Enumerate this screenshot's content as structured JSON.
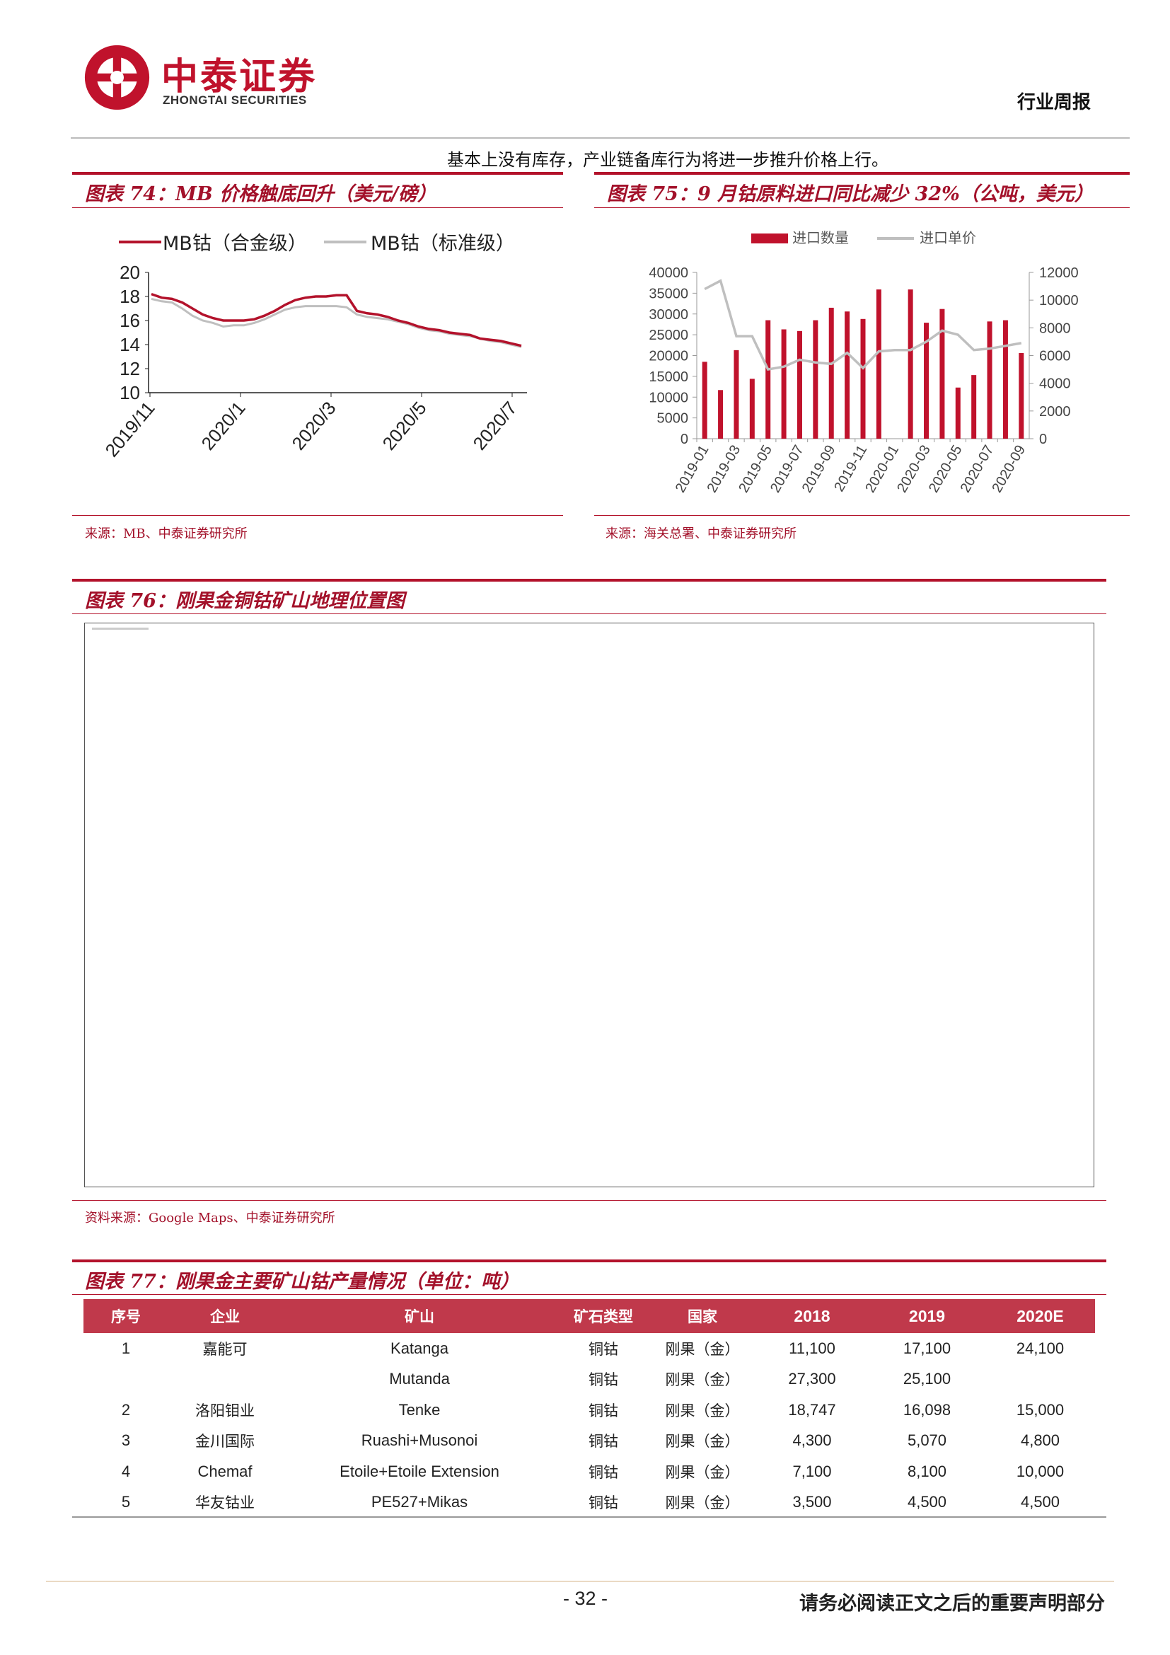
{
  "header": {
    "brand_cn": "中泰证券",
    "brand_en": "ZHONGTAI SECURITIES",
    "report_type": "行业周报",
    "brand_color": "#c0122c"
  },
  "intro_text": "基本上没有库存，产业链备库行为将进一步推升价格上行。",
  "fig74": {
    "title": "图表 74：MB 价格触底回升（美元/磅）",
    "source": "来源：MB、中泰证券研究所"
  },
  "fig75": {
    "title": "图表 75：9 月钴原料进口同比减少 32%（公吨，美元）",
    "source": "来源：海关总署、中泰证券研究所"
  },
  "fig76": {
    "title": "图表 76：刚果金铜钴矿山地理位置图",
    "source": "资料来源：Google Maps、中泰证券研究所"
  },
  "fig77": {
    "title": "图表 77：刚果金主要矿山钴产量情况（单位：吨）",
    "headers": [
      "序号",
      "企业",
      "矿山",
      "矿石类型",
      "国家",
      "2018",
      "2019",
      "2020E"
    ],
    "rows": [
      [
        "1",
        "嘉能可",
        "Katanga",
        "铜钴",
        "刚果（金）",
        "11,100",
        "17,100",
        "24,100"
      ],
      [
        "",
        "",
        "Mutanda",
        "铜钴",
        "刚果（金）",
        "27,300",
        "25,100",
        ""
      ],
      [
        "2",
        "洛阳钼业",
        "Tenke",
        "铜钴",
        "刚果（金）",
        "18,747",
        "16,098",
        "15,000"
      ],
      [
        "3",
        "金川国际",
        "Ruashi+Musonoi",
        "铜钴",
        "刚果（金）",
        "4,300",
        "5,070",
        "4,800"
      ],
      [
        "4",
        "Chemaf",
        "Etoile+Etoile Extension",
        "铜钴",
        "刚果（金）",
        "7,100",
        "8,100",
        "10,000"
      ],
      [
        "5",
        "华友钴业",
        "PE527+Mikas",
        "铜钴",
        "刚果（金）",
        "3,500",
        "4,500",
        "4,500"
      ]
    ]
  },
  "footer": {
    "page_number": "- 32 -",
    "note": "请务必阅读正文之后的重要声明部分"
  },
  "chart_data": [
    {
      "type": "line",
      "series": [
        {
          "name": "MB钴（合金级）",
          "color": "#b3122b",
          "values": [
            18.2,
            17.9,
            17.8,
            17.5,
            17.0,
            16.5,
            16.2,
            16.0,
            16.0,
            16.0,
            16.1,
            16.4,
            16.8,
            17.3,
            17.7,
            17.9,
            18.0,
            18.0,
            18.1,
            18.1,
            16.8,
            16.6,
            16.5,
            16.3,
            16.0,
            15.8,
            15.5,
            15.3,
            15.2,
            15.0,
            14.9,
            14.8,
            14.5,
            14.4,
            14.3,
            14.1,
            13.9
          ]
        },
        {
          "name": "MB钴（标准级）",
          "color": "#bfbfbf",
          "values": [
            17.8,
            17.6,
            17.5,
            17.0,
            16.4,
            16.0,
            15.8,
            15.5,
            15.6,
            15.6,
            15.8,
            16.1,
            16.5,
            16.9,
            17.1,
            17.2,
            17.2,
            17.2,
            17.2,
            17.1,
            16.5,
            16.3,
            16.2,
            16.1,
            15.9,
            15.7,
            15.4,
            15.2,
            15.1,
            14.9,
            14.8,
            14.7,
            14.5,
            14.3,
            14.2,
            14.0,
            13.8
          ]
        }
      ],
      "x_ticks": [
        "2019/11",
        "2020/1",
        "2020/3",
        "2020/5",
        "2020/7"
      ],
      "y_ticks": [
        "20",
        "18",
        "16",
        "14",
        "12",
        "10"
      ],
      "ylim": [
        10,
        20
      ]
    },
    {
      "type": "bar",
      "categories": [
        "2019-01",
        "2019-02",
        "2019-03",
        "2019-04",
        "2019-05",
        "2019-06",
        "2019-07",
        "2019-08",
        "2019-09",
        "2019-10",
        "2019-11",
        "2019-12",
        "2020-01",
        "2020-02",
        "2020-03",
        "2020-04",
        "2020-05",
        "2020-06",
        "2020-07",
        "2020-08",
        "2020-09"
      ],
      "x_tick_labels": [
        "2019-01",
        "2019-03",
        "2019-05",
        "2019-07",
        "2019-09",
        "2019-11",
        "2020-01",
        "2020-03",
        "2020-05",
        "2020-07",
        "2020-09"
      ],
      "series": [
        {
          "name": "进口数量",
          "axis": "left",
          "color": "#c0122c",
          "values": [
            18500,
            11700,
            21300,
            14400,
            28500,
            26300,
            25900,
            28500,
            31500,
            30600,
            28800,
            35900,
            0,
            35900,
            27900,
            31200,
            12300,
            15300,
            28200,
            28500,
            20600
          ]
        },
        {
          "name": "进口单价",
          "axis": "right",
          "color": "#bfbfbf",
          "type": "line",
          "values": [
            10800,
            11400,
            7400,
            7400,
            5000,
            5200,
            5700,
            5500,
            5400,
            6200,
            5100,
            6300,
            6400,
            6400,
            7000,
            7800,
            7500,
            6400,
            6500,
            6700,
            6900
          ]
        }
      ],
      "y_left_ticks": [
        "40000",
        "35000",
        "30000",
        "25000",
        "20000",
        "15000",
        "10000",
        "5000",
        "0"
      ],
      "y_right_ticks": [
        "12000",
        "10000",
        "8000",
        "6000",
        "4000",
        "2000",
        "0"
      ],
      "ylim_left": [
        0,
        40000
      ],
      "ylim_right": [
        0,
        12000
      ]
    }
  ]
}
